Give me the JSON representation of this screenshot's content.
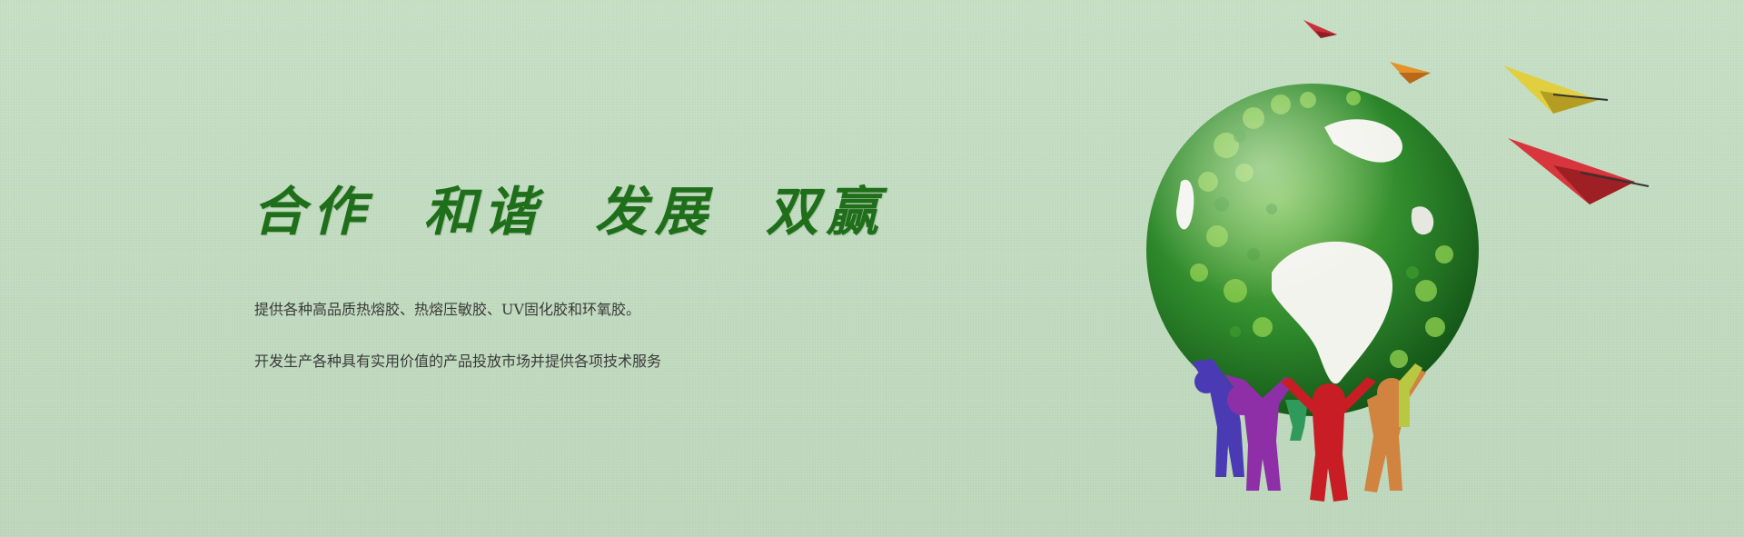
{
  "banner": {
    "slogan": "合作  和谐  发展  双赢",
    "lines": [
      "提供各种高品质热熔胶、热熔压敏胶、UV固化胶和环氧胶。",
      "开发生产各种具有实用价值的产品投放市场并提供各项技术服务"
    ],
    "illustration": {
      "subject": "globe-held-by-figures",
      "figure_colors": [
        "#4a3bb5",
        "#8e2fa8",
        "#c81d25",
        "#d0843f",
        "#2f9a5a",
        "#b9c842"
      ],
      "plane_colors": [
        "#c9303a",
        "#e3932a",
        "#e2cf3f",
        "#d8363d"
      ]
    },
    "colors": {
      "background": "#c3dcc2",
      "slogan": "#1f6e1a",
      "text": "#3a3a3a"
    }
  }
}
